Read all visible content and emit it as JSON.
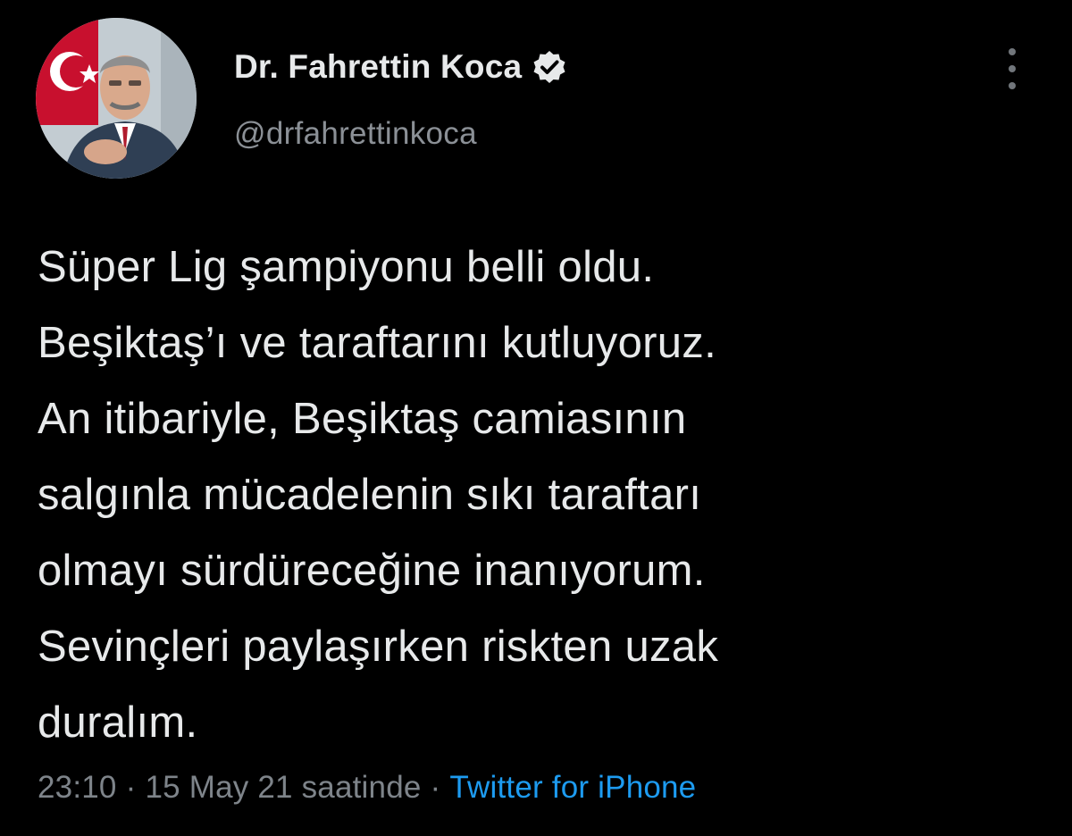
{
  "author": {
    "display_name": "Dr. Fahrettin Koca",
    "handle": "@drfahrettinkoca",
    "verified_icon": "verified-badge-icon",
    "avatar_icon": "avatar"
  },
  "tweet": {
    "text": "Süper Lig şampiyonu belli oldu.\nBeşiktaş’ı ve taraftarını kutluyoruz.\nAn itibariyle, Beşiktaş camiasının\nsalgınla mücadelenin sıkı taraftarı\nolmayı sürdüreceğine inanıyorum.\nSevinçleri paylaşırken riskten uzak\nduralım.",
    "time": "23:10",
    "separator": "·",
    "date": "15 May 21 saatinde",
    "source": "Twitter for iPhone"
  },
  "colors": {
    "background": "#000000",
    "text": "#e7e9ea",
    "secondary": "#7e848a",
    "link": "#1d9bf0"
  },
  "menu": {
    "icon": "more-options-icon"
  }
}
